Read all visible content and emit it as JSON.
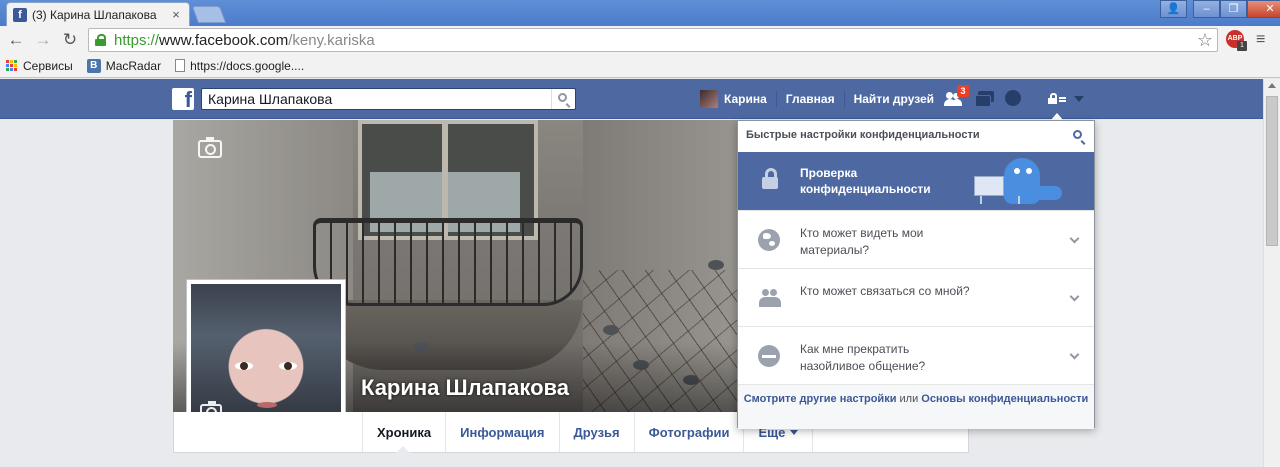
{
  "browser": {
    "tab_title": "(3) Карина Шлапакова",
    "tab_favicon": "f",
    "tab_close": "×",
    "url_scheme": "https://",
    "url_host": "www.facebook.com",
    "url_path": "/keny.kariska",
    "abp_label": "ABP",
    "abp_count": "1",
    "nav": {
      "back": "←",
      "forward": "→",
      "reload": "↻",
      "menu": "≡",
      "star": "☆"
    },
    "window_controls": {
      "user": "👤",
      "minimize": "–",
      "restore": "❐",
      "close": "✕"
    },
    "bookmarks": [
      {
        "label": "Сервисы",
        "icon": "apps-grid-icon"
      },
      {
        "label": "MacRadar ",
        "icon": "vk-icon",
        "icon_text": "В"
      },
      {
        "label": "https://docs.google....",
        "icon": "document-icon"
      }
    ]
  },
  "fb": {
    "logo": "f",
    "search_value": "Карина Шлапакова",
    "user_name": "Карина",
    "home_label": "Главная",
    "find_friends_label": "Найти друзей",
    "friend_requests_badge": "3",
    "brand_color": "#4e69a2"
  },
  "profile": {
    "name": "Карина Шлапакова",
    "tabs": [
      {
        "label": "Хроника",
        "active": true
      },
      {
        "label": "Информация"
      },
      {
        "label": "Друзья"
      },
      {
        "label": "Фотографии"
      },
      {
        "label": "Еще",
        "dropdown": true
      }
    ]
  },
  "privacy_menu": {
    "header": "Быстрые настройки конфиденциальности",
    "checkup_title": "Проверка конфиденциальности",
    "items": [
      {
        "label": "Кто может видеть мои материалы?",
        "icon": "globe-icon"
      },
      {
        "label": "Кто может связаться со мной?",
        "icon": "people-icon"
      },
      {
        "label": "Как мне прекратить назойливое общение?",
        "icon": "block-icon"
      }
    ],
    "footer_link1": "Смотрите другие настройки",
    "footer_or": " или ",
    "footer_link2": "Основы конфиденциальности"
  }
}
